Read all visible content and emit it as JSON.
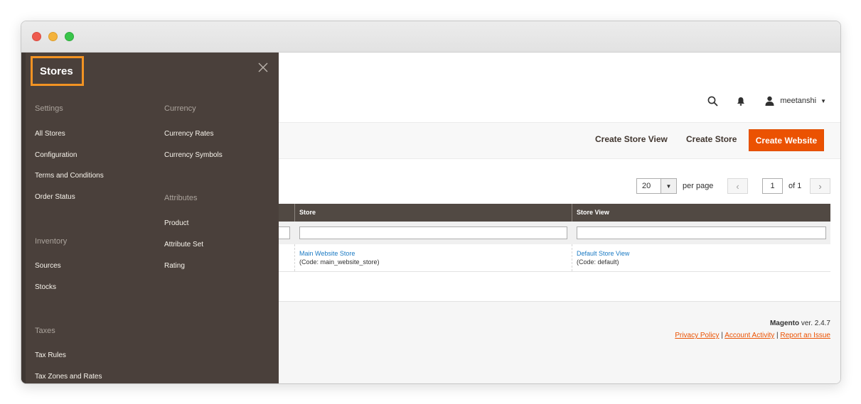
{
  "header": {
    "username": "meetanshi"
  },
  "actions": {
    "create_store_view": "Create Store View",
    "create_store": "Create Store",
    "create_website": "Create Website"
  },
  "pager": {
    "per_page_value": "20",
    "per_page_label": "per page",
    "page_value": "1",
    "of_label": "of 1"
  },
  "grid": {
    "columns": [
      "Store",
      "Store View"
    ],
    "rows": [
      {
        "store_name": "Main Website Store",
        "store_code": "(Code: main_website_store)",
        "store_view_name": "Default Store View",
        "store_view_code": "(Code: default)"
      }
    ]
  },
  "footer": {
    "brand": "Magento",
    "version": "ver. 2.4.7",
    "links": [
      "Privacy Policy",
      "Account Activity",
      "Report an Issue"
    ],
    "separator": "|"
  },
  "sidebar": {
    "title": "Stores",
    "close_icon": "close-icon",
    "sections": [
      {
        "title": "Settings",
        "items": [
          "All Stores",
          "Configuration",
          "Terms and Conditions",
          "Order Status"
        ]
      },
      {
        "title": "Inventory",
        "items": [
          "Sources",
          "Stocks"
        ]
      },
      {
        "title": "Taxes",
        "items": [
          "Tax Rules",
          "Tax Zones and Rates"
        ]
      },
      {
        "title": "Currency",
        "items": [
          "Currency Rates",
          "Currency Symbols"
        ]
      },
      {
        "title": "Attributes",
        "items": [
          "Product",
          "Attribute Set",
          "Rating"
        ]
      }
    ]
  },
  "colors": {
    "accent": "#eb5202",
    "sidebar_bg": "#4a403b",
    "highlight": "#f29323",
    "link": "#1979c3",
    "grid_header": "#514943"
  },
  "icons": [
    "search-icon",
    "bell-icon",
    "user-icon",
    "close-icon",
    "chevron-left-icon",
    "chevron-right-icon",
    "caret-down-icon"
  ]
}
